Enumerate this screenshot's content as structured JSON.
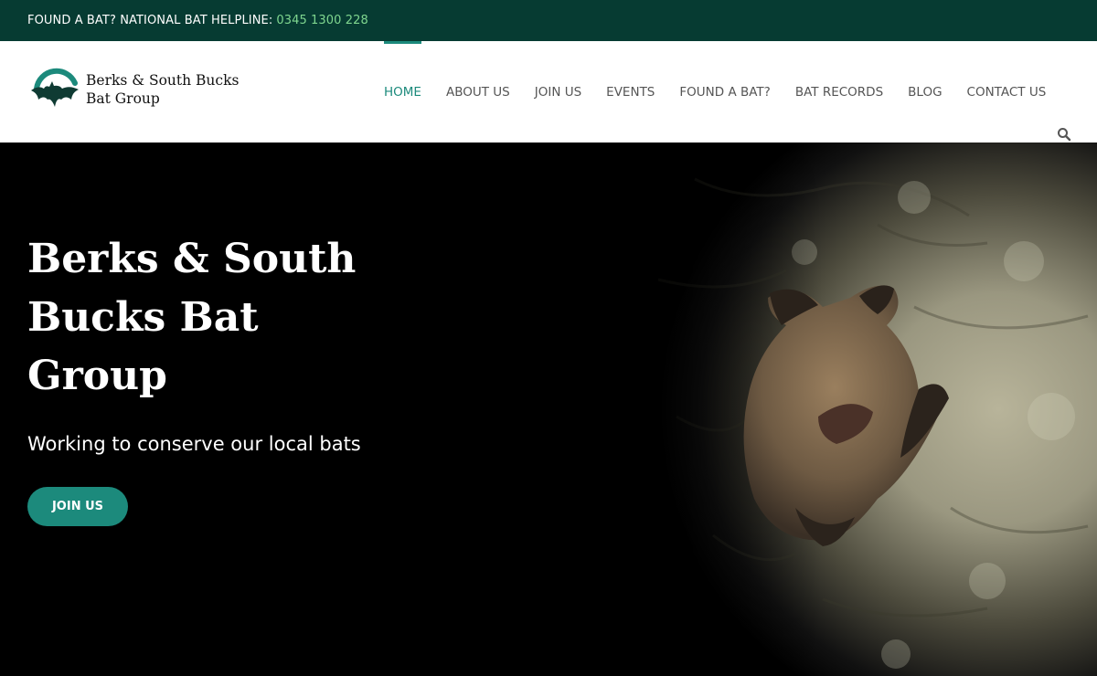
{
  "topbar": {
    "helpline_text": "FOUND A BAT? NATIONAL BAT HELPLINE:",
    "helpline_number": "0345 1300 228"
  },
  "logo": {
    "line1": "Berks & South Bucks",
    "line2": "Bat Group"
  },
  "nav": {
    "items": [
      {
        "label": "HOME",
        "active": true
      },
      {
        "label": "ABOUT US",
        "active": false
      },
      {
        "label": "JOIN US",
        "active": false
      },
      {
        "label": "EVENTS",
        "active": false
      },
      {
        "label": "FOUND A BAT?",
        "active": false
      },
      {
        "label": "BAT RECORDS",
        "active": false
      },
      {
        "label": "BLOG",
        "active": false
      },
      {
        "label": "CONTACT US",
        "active": false
      }
    ],
    "search_icon": "search-icon"
  },
  "hero": {
    "title": "Berks & South Bucks Bat Group",
    "subtitle": "Working to conserve our local bats",
    "cta_label": "JOIN US",
    "image_subject": "bat-on-tree-bark"
  },
  "colors": {
    "topbar_bg": "#063b32",
    "accent": "#1c8a7c",
    "phone": "#7fd68f"
  }
}
